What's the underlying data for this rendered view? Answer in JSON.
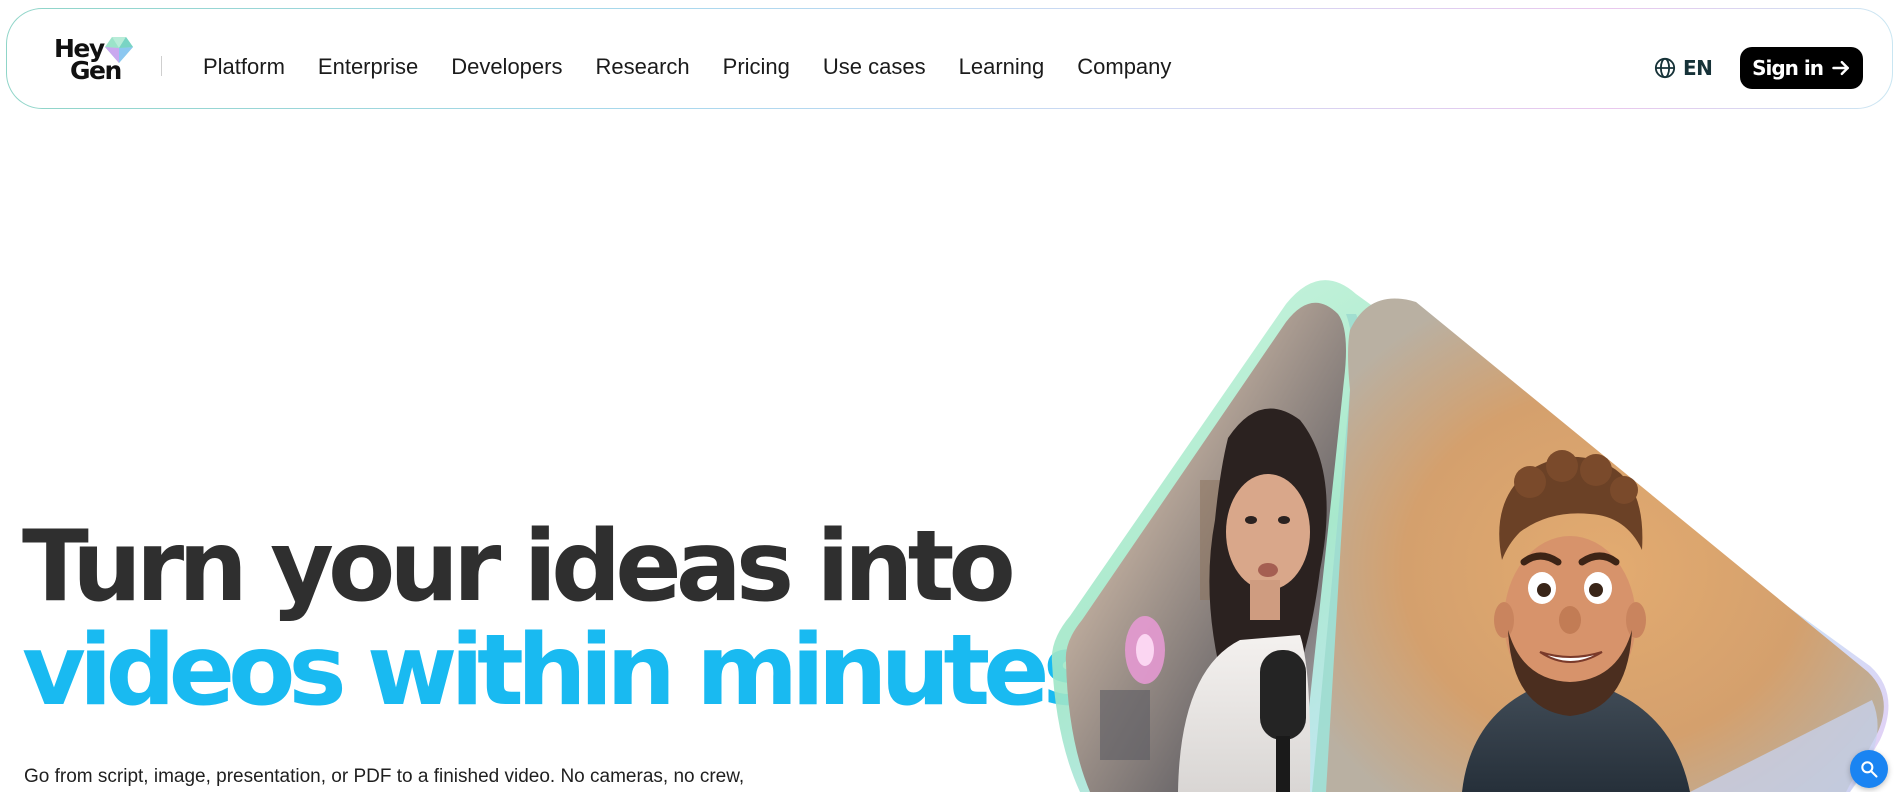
{
  "header": {
    "logo": {
      "line1": "Hey",
      "line2": "Gen"
    },
    "nav": [
      {
        "label": "Platform"
      },
      {
        "label": "Enterprise"
      },
      {
        "label": "Developers"
      },
      {
        "label": "Research"
      },
      {
        "label": "Pricing"
      },
      {
        "label": "Use cases"
      },
      {
        "label": "Learning"
      },
      {
        "label": "Company"
      }
    ],
    "language": {
      "label": "EN",
      "icon": "globe-icon"
    },
    "signin": {
      "label": "Sign in",
      "icon": "arrow-right-icon"
    }
  },
  "hero": {
    "headline_line1": "Turn your ideas into",
    "headline_line2": "videos within minutes",
    "subtext": "Go from script, image, presentation, or PDF to a finished video. No cameras, no crew,"
  },
  "colors": {
    "accent": "#19baf1",
    "headline": "#2f2f2f",
    "signin_bg": "#000000",
    "chat_fab": "#1a84f2"
  },
  "widgets": {
    "chat_button": {
      "icon": "chat-search-icon"
    }
  }
}
